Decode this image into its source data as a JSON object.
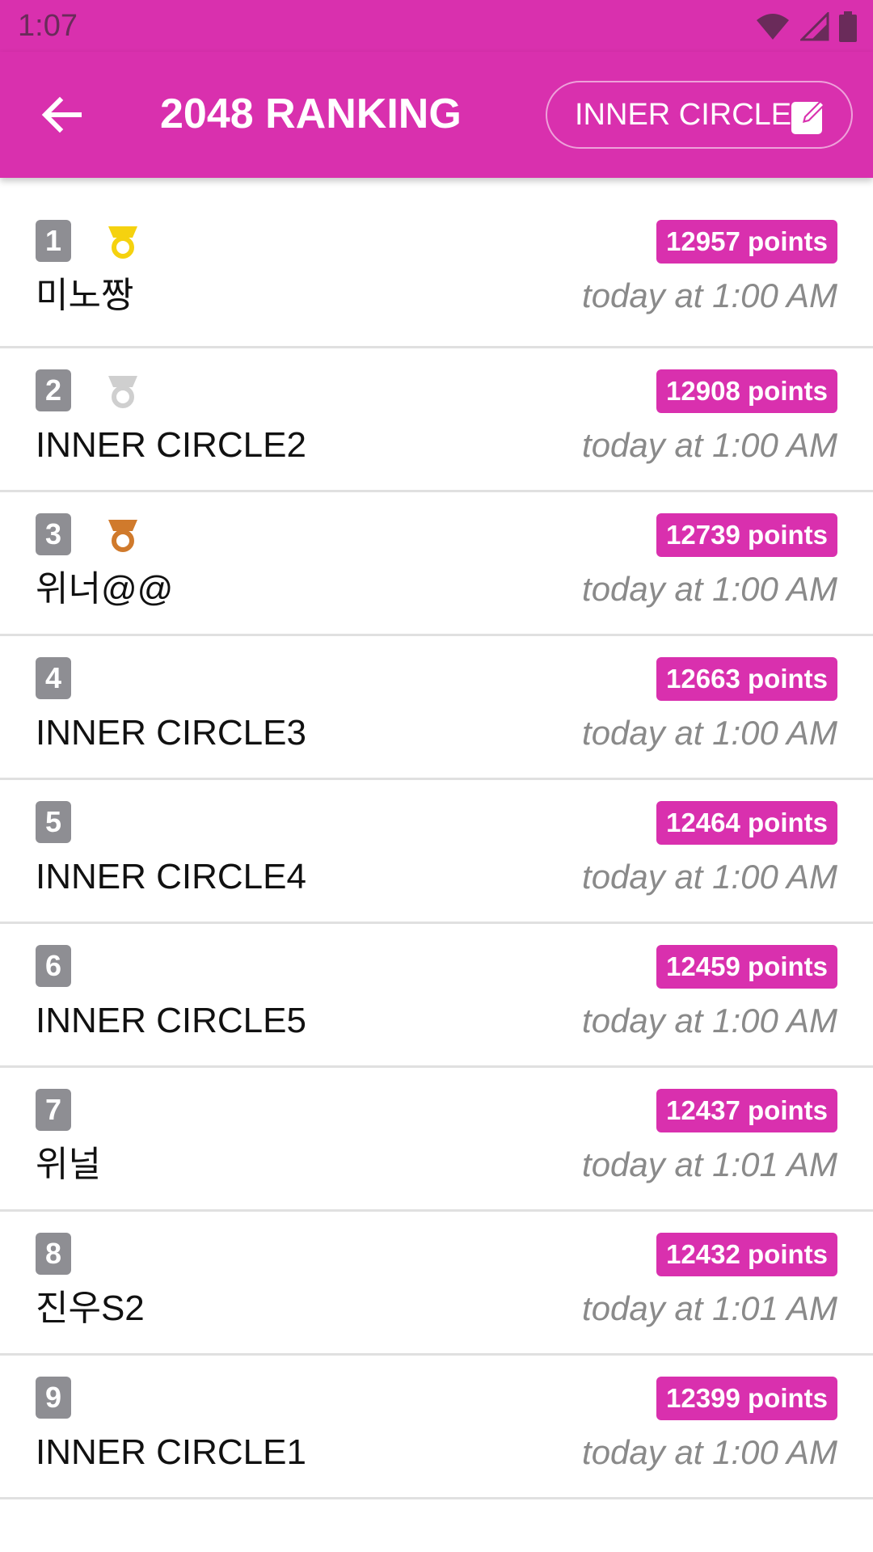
{
  "status_bar": {
    "time": "1:07",
    "icons": [
      "wifi-icon",
      "signal-icon",
      "battery-icon"
    ]
  },
  "app_bar": {
    "title": "2048 RANKING",
    "back_icon": "arrow-back-icon",
    "action_label": "INNER CIRCLE",
    "action_icon": "edit-icon"
  },
  "colors": {
    "primary": "#d930ae",
    "rank_badge": "#8e8e93",
    "gold": "#f5d20f",
    "silver": "#cfcfcf",
    "bronze": "#d07a2c"
  },
  "rankings": [
    {
      "rank": "1",
      "medal": "gold-medal-icon",
      "name": "미노짱",
      "points": "12957 points",
      "time": "today at 1:00 AM"
    },
    {
      "rank": "2",
      "medal": "silver-medal-icon",
      "name": "INNER CIRCLE2",
      "points": "12908 points",
      "time": "today at 1:00 AM"
    },
    {
      "rank": "3",
      "medal": "bronze-medal-icon",
      "name": "위너@@",
      "points": "12739 points",
      "time": "today at 1:00 AM"
    },
    {
      "rank": "4",
      "medal": "",
      "name": "INNER CIRCLE3",
      "points": "12663 points",
      "time": "today at 1:00 AM"
    },
    {
      "rank": "5",
      "medal": "",
      "name": "INNER CIRCLE4",
      "points": "12464 points",
      "time": "today at 1:00 AM"
    },
    {
      "rank": "6",
      "medal": "",
      "name": "INNER CIRCLE5",
      "points": "12459 points",
      "time": "today at 1:00 AM"
    },
    {
      "rank": "7",
      "medal": "",
      "name": "위널",
      "points": "12437 points",
      "time": "today at 1:01 AM"
    },
    {
      "rank": "8",
      "medal": "",
      "name": "진우S2",
      "points": "12432 points",
      "time": "today at 1:01 AM"
    },
    {
      "rank": "9",
      "medal": "",
      "name": "INNER CIRCLE1",
      "points": "12399 points",
      "time": "today at 1:00 AM"
    }
  ]
}
